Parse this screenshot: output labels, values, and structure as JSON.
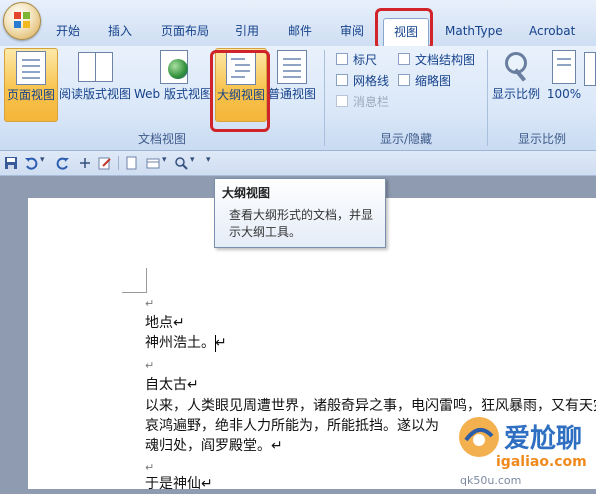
{
  "tabs": [
    "开始",
    "插入",
    "页面布局",
    "引用",
    "邮件",
    "审阅",
    "视图",
    "MathType",
    "Acrobat"
  ],
  "active_tab": "视图",
  "ribbon": {
    "doc_views": {
      "group_label": "文档视图",
      "buttons": [
        "页面视图",
        "阅读版式视图",
        "Web 版式视图",
        "大纲视图",
        "普通视图"
      ]
    },
    "show_hide": {
      "group_label": "显示/隐藏",
      "checkboxes": [
        "标尺",
        "文档结构图",
        "网格线",
        "缩略图",
        "消息栏"
      ]
    },
    "zoom": {
      "group_label": "显示比例",
      "buttons": [
        "显示比例",
        "100%"
      ]
    }
  },
  "tooltip": {
    "title": "大纲视图",
    "body": "查看大纲形式的文档，并显示大纲工具。"
  },
  "document": {
    "lines": [
      "↵",
      "地点↵",
      "神州浩土。↵",
      "↵",
      "自太古↵",
      "以来，人类眼见周遭世界，诸般奇异之事，电闪雷鸣，狂风暴雨，又有天灾人",
      "哀鸿遍野，绝非人力所能为，所能抵挡。遂以为",
      "魂归处，阎罗殿堂。↵",
      "↵",
      "于是神仙↵"
    ]
  },
  "watermark": {
    "text": "爱尬聊",
    "url": "igaliao.com",
    "small": "qk50u.com"
  },
  "colors": {
    "highlight_red": "#d0232a",
    "active_button": "#f8c44f",
    "ribbon_text": "#15428b"
  }
}
